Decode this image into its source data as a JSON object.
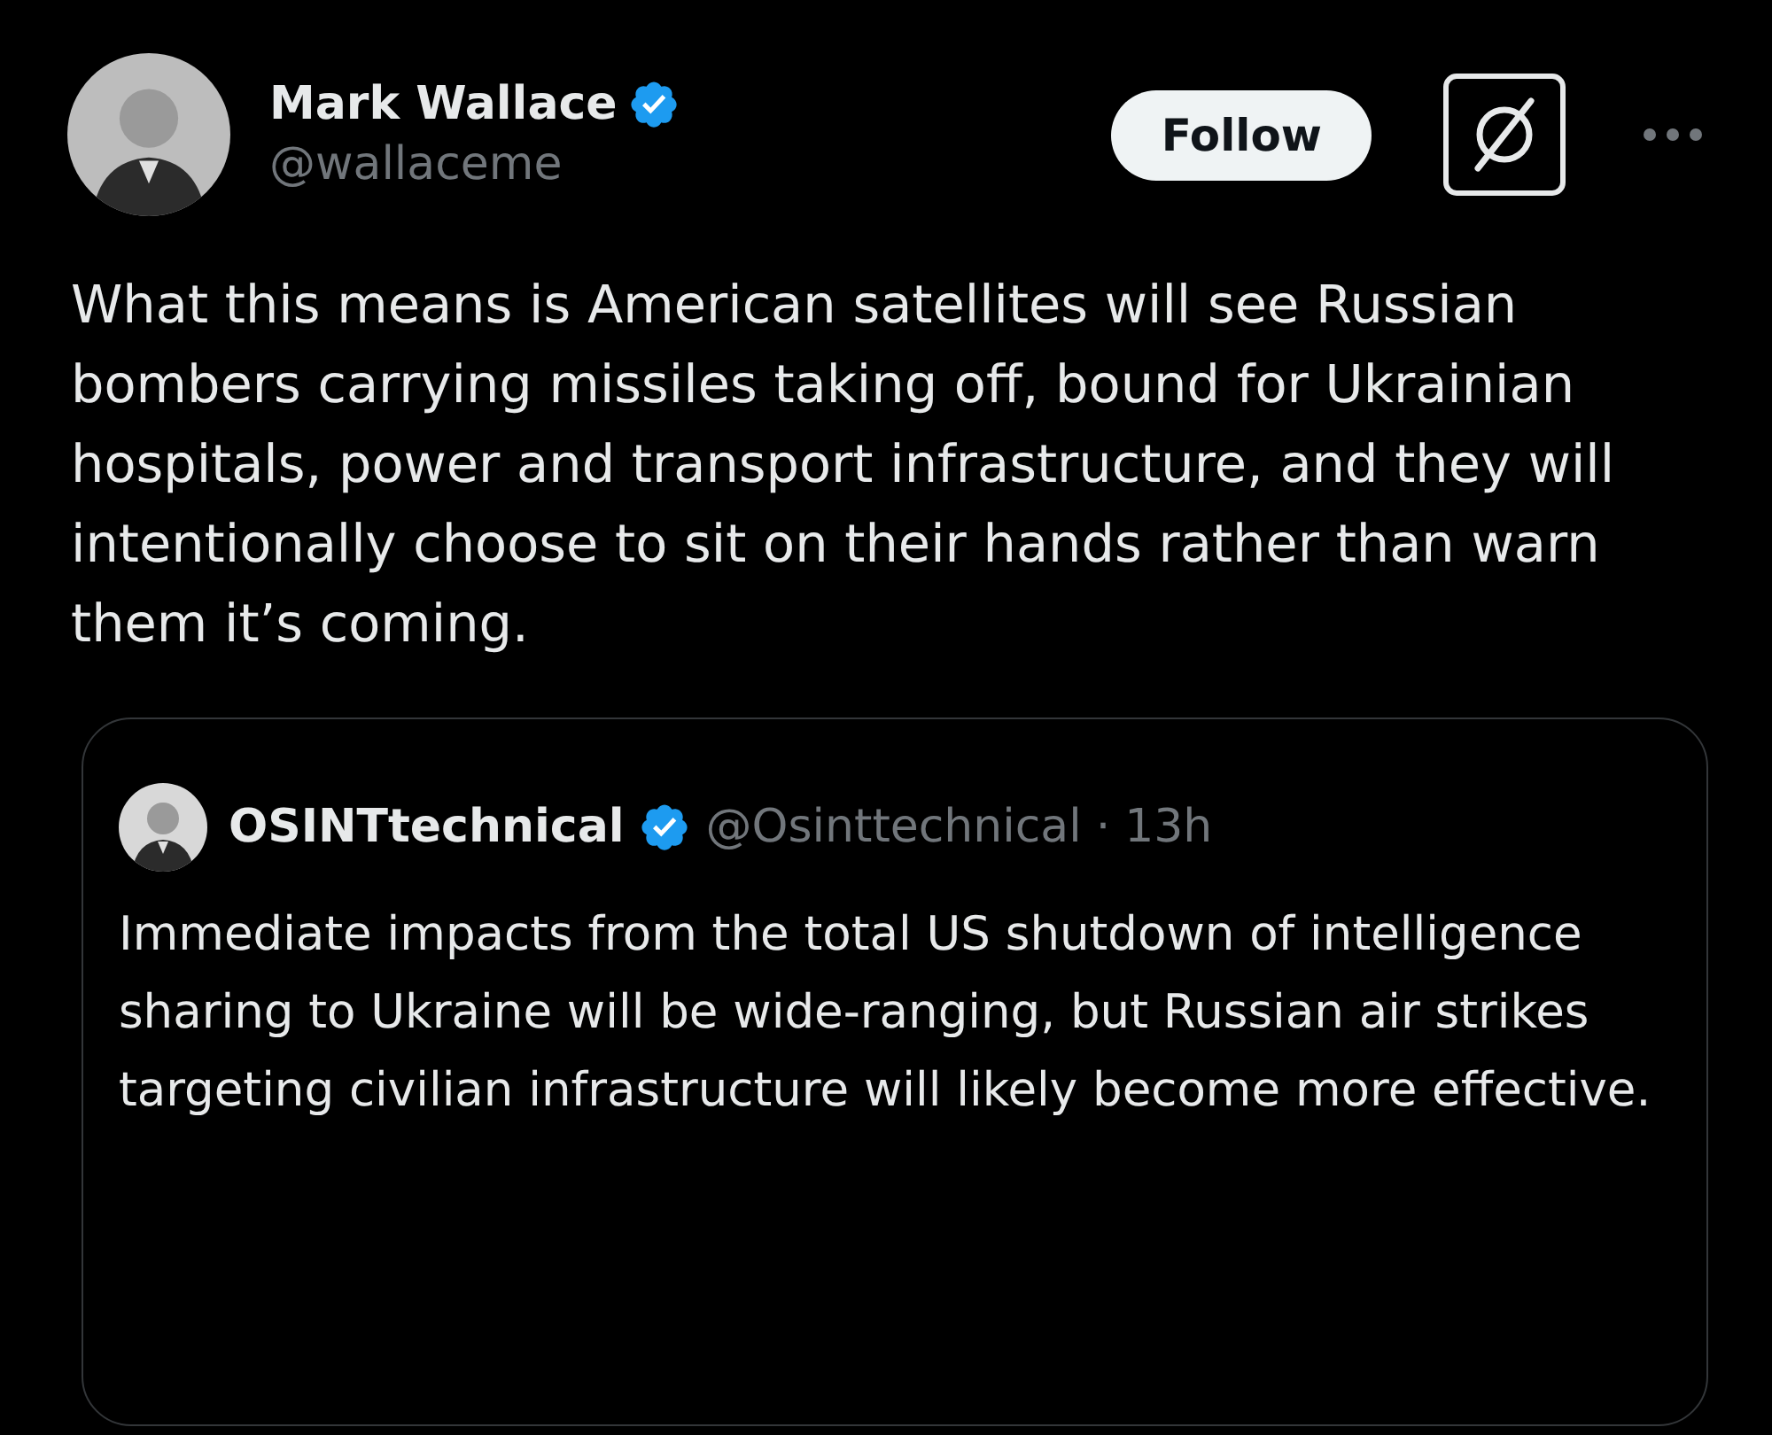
{
  "author": {
    "name": "Mark Wallace",
    "handle": "@wallaceme",
    "verified": true
  },
  "follow_button": {
    "label": "Follow"
  },
  "text": "What this means is American satellites will see Russian bombers carrying missiles taking off, bound for Ukrainian hospitals, power and transport infrastructure, and they will intentionally choose to sit on their hands rather than warn them it’s coming.",
  "quoted_post": {
    "name": "OSINTtechnical",
    "verified": true,
    "handle": "@Osinttechnical",
    "separator": "·",
    "time": "13h",
    "text": "Immediate impacts from the total US shutdown of intelligence sharing to Ukraine will be wide-ranging, but Russian air strikes  targeting civilian infrastructure will likely become more effective."
  }
}
